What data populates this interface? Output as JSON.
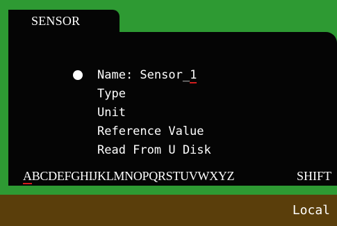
{
  "tab": {
    "label": "SENSOR"
  },
  "menu": {
    "items": [
      {
        "prefix": "Name: Sensor_",
        "cursor_char": "1"
      },
      {
        "label": "Type"
      },
      {
        "label": "Unit"
      },
      {
        "label": "Reference Value"
      },
      {
        "label": "Read From U Disk"
      }
    ]
  },
  "keyboard": {
    "first": "A",
    "rest": "BCDEFGHIJKLMNOPQRSTUVWXYZ",
    "shift_label": "SHIFT"
  },
  "status": {
    "mode": "Local"
  },
  "colors": {
    "frame": "#2e9a33",
    "panel": "#050505",
    "statusbar": "#5a3e0b",
    "cursor": "#d21e1e"
  }
}
